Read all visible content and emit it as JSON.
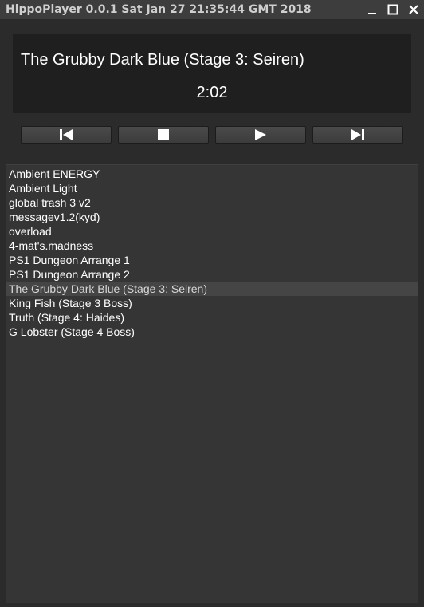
{
  "window": {
    "title": "HippoPlayer 0.0.1 Sat Jan 27 21:35:44 GMT 2018",
    "controls": [
      "minimize-icon",
      "maximize-icon",
      "close-icon"
    ]
  },
  "now_playing": {
    "title": "The Grubby Dark Blue (Stage 3: Seiren)",
    "time": "2:02"
  },
  "transport": {
    "buttons": [
      "previous-icon",
      "stop-icon",
      "play-icon",
      "next-icon"
    ]
  },
  "playlist": {
    "current_index": 8,
    "items": [
      "Ambient ENERGY",
      "Ambient Light",
      "global trash 3 v2",
      "messagev1.2(kyd)",
      "overload",
      "4-mat's.madness",
      "PS1 Dungeon Arrange 1",
      "PS1 Dungeon Arrange 2",
      "The Grubby Dark Blue (Stage 3: Seiren)",
      "King Fish (Stage 3 Boss)",
      "Truth (Stage 4: Haides)",
      "G Lobster (Stage 4 Boss)"
    ]
  },
  "colors": {
    "background": "#2b2b2b",
    "panel": "#1f1f1f",
    "playlist_bg": "#353535",
    "highlight": "#454545",
    "text": "#ffffff"
  }
}
